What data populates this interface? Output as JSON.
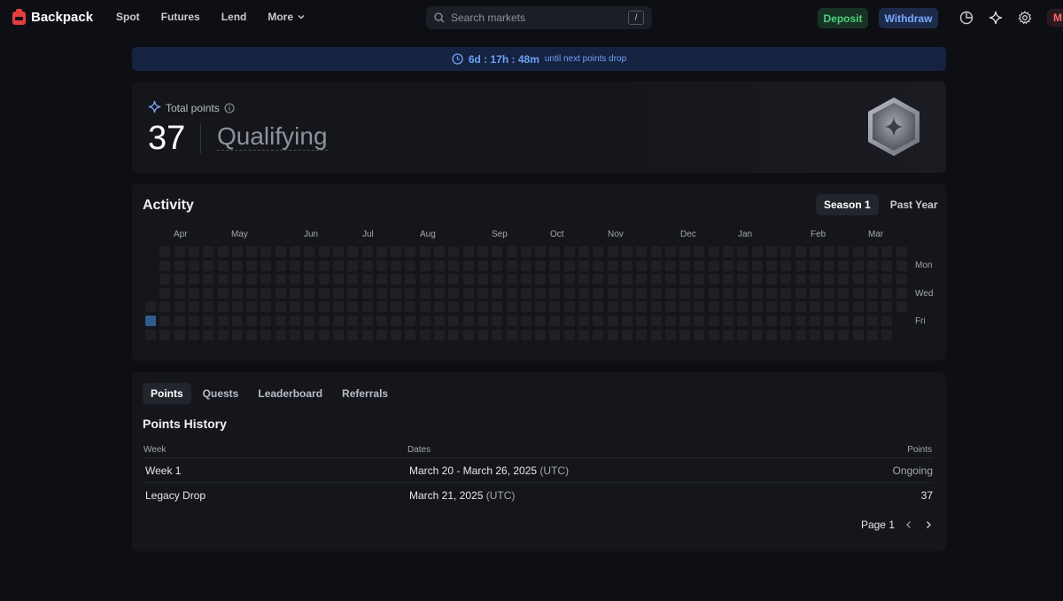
{
  "nav": {
    "brand": "Backpack",
    "links": [
      "Spot",
      "Futures",
      "Lend",
      "More"
    ],
    "search_placeholder": "Search markets",
    "search_shortcut": "/",
    "deposit_label": "Deposit",
    "withdraw_label": "Withdraw",
    "avatar_initial": "M",
    "icons": [
      "chart-pie-icon",
      "sparkle-icon",
      "gear-icon"
    ]
  },
  "banner": {
    "timer": "6d : 17h : 48m",
    "subtitle": "until next points drop"
  },
  "points": {
    "label": "Total points",
    "value": "37",
    "status": "Qualifying"
  },
  "activity": {
    "title": "Activity",
    "tabs": [
      "Season 1",
      "Past Year"
    ],
    "active_tab": "Season 1",
    "months": [
      "Apr",
      "May",
      "Jun",
      "Jul",
      "Aug",
      "Sep",
      "Oct",
      "Nov",
      "Dec",
      "Jan",
      "Feb",
      "Mar"
    ],
    "days": [
      "Mon",
      "Wed",
      "Fri"
    ],
    "active_color": "#2f5d8c",
    "cell_color": "#1f2026"
  },
  "history": {
    "tabs": [
      "Points",
      "Quests",
      "Leaderboard",
      "Referrals"
    ],
    "active_tab": "Points",
    "title": "Points History",
    "columns": [
      "Week",
      "Dates",
      "Points"
    ],
    "rows": [
      {
        "week": "Week 1",
        "dates": "March 20 - March 26, 2025",
        "tz": "(UTC)",
        "points": "Ongoing"
      },
      {
        "week": "Legacy Drop",
        "dates": "March 21, 2025",
        "tz": "(UTC)",
        "points": "37"
      }
    ],
    "page_label": "Page 1"
  }
}
